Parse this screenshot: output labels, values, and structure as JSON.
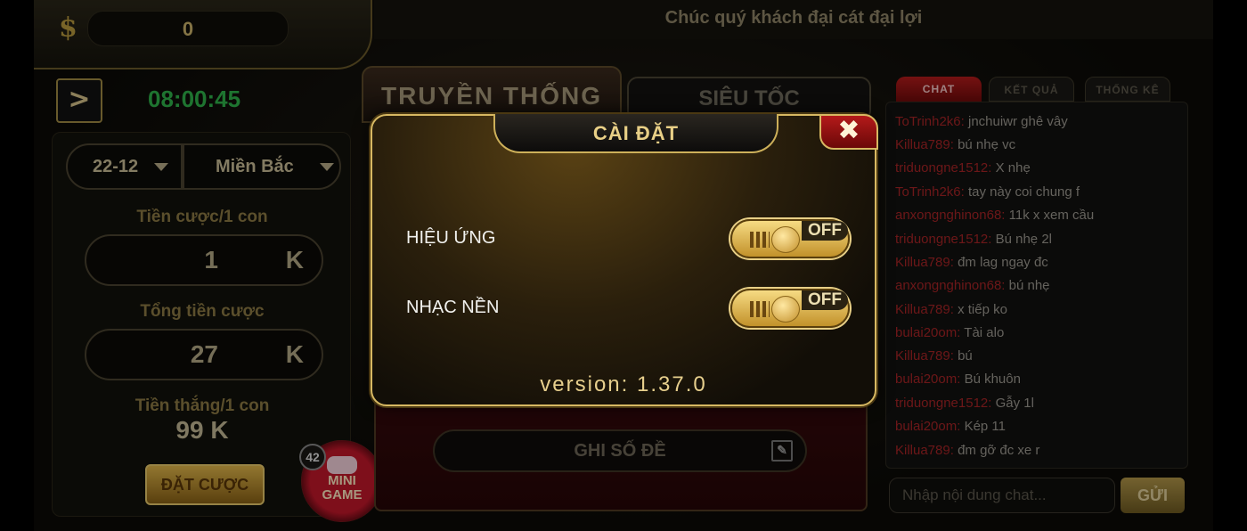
{
  "top": {
    "currency_symbol": "$",
    "balance": "0",
    "marquee": "Chúc quý khách đại cát đại lợi"
  },
  "left": {
    "nav_arrow": ">",
    "timer": "08:00:45",
    "date_select": "22-12",
    "region_select": "Miền Bắc",
    "bet_per_label": "Tiền cược/1 con",
    "bet_per_value": "1",
    "bet_per_unit": "K",
    "total_label": "Tổng tiền cược",
    "total_value": "27",
    "total_unit": "K",
    "win_label": "Tiền thắng/1 con",
    "win_value": "99 K",
    "bet_button": "ĐẶT CƯỢC"
  },
  "mini_game": {
    "badge": "42",
    "line1": "MINI",
    "line2": "GAME"
  },
  "center": {
    "tab_traditional": "TRUYỀN THỐNG",
    "tab_fast": "SIÊU TỐC",
    "note_button": "GHI SỐ ĐỀ"
  },
  "chat": {
    "tabs": [
      "CHAT",
      "KẾT QUẢ",
      "THỐNG KÊ"
    ],
    "messages": [
      {
        "user": "ToTrinh2k6:",
        "text": "jnchuiwr ghê vây"
      },
      {
        "user": "Killua789:",
        "text": "bú nhẹ vc"
      },
      {
        "user": "triduongne1512:",
        "text": "X nhẹ"
      },
      {
        "user": "ToTrinh2k6:",
        "text": "tay này coi chung f"
      },
      {
        "user": "anxongnghinon68:",
        "text": "11k x xem cầu"
      },
      {
        "user": "triduongne1512:",
        "text": "Bú nhẹ 2l"
      },
      {
        "user": "Killua789:",
        "text": "đm lag ngay đc"
      },
      {
        "user": "anxongnghinon68:",
        "text": "bú nhẹ"
      },
      {
        "user": "Killua789:",
        "text": "x tiếp ko"
      },
      {
        "user": "bulai20om:",
        "text": "Tài alo"
      },
      {
        "user": "Killua789:",
        "text": "bú"
      },
      {
        "user": "bulai20om:",
        "text": "Bú khuôn"
      },
      {
        "user": "triduongne1512:",
        "text": "Gẫy 1l"
      },
      {
        "user": "bulai20om:",
        "text": "Kép 11"
      },
      {
        "user": "Killua789:",
        "text": "đm gỡ đc xe r"
      }
    ],
    "input_placeholder": "Nhập nội dung chat...",
    "send_button": "GỬI"
  },
  "dialog": {
    "title": "CÀI ĐẶT",
    "close_glyph": "✖",
    "effects_label": "HIỆU ỨNG",
    "effects_state": "OFF",
    "music_label": "NHẠC NỀN",
    "music_state": "OFF",
    "version": "version: 1.37.0"
  }
}
